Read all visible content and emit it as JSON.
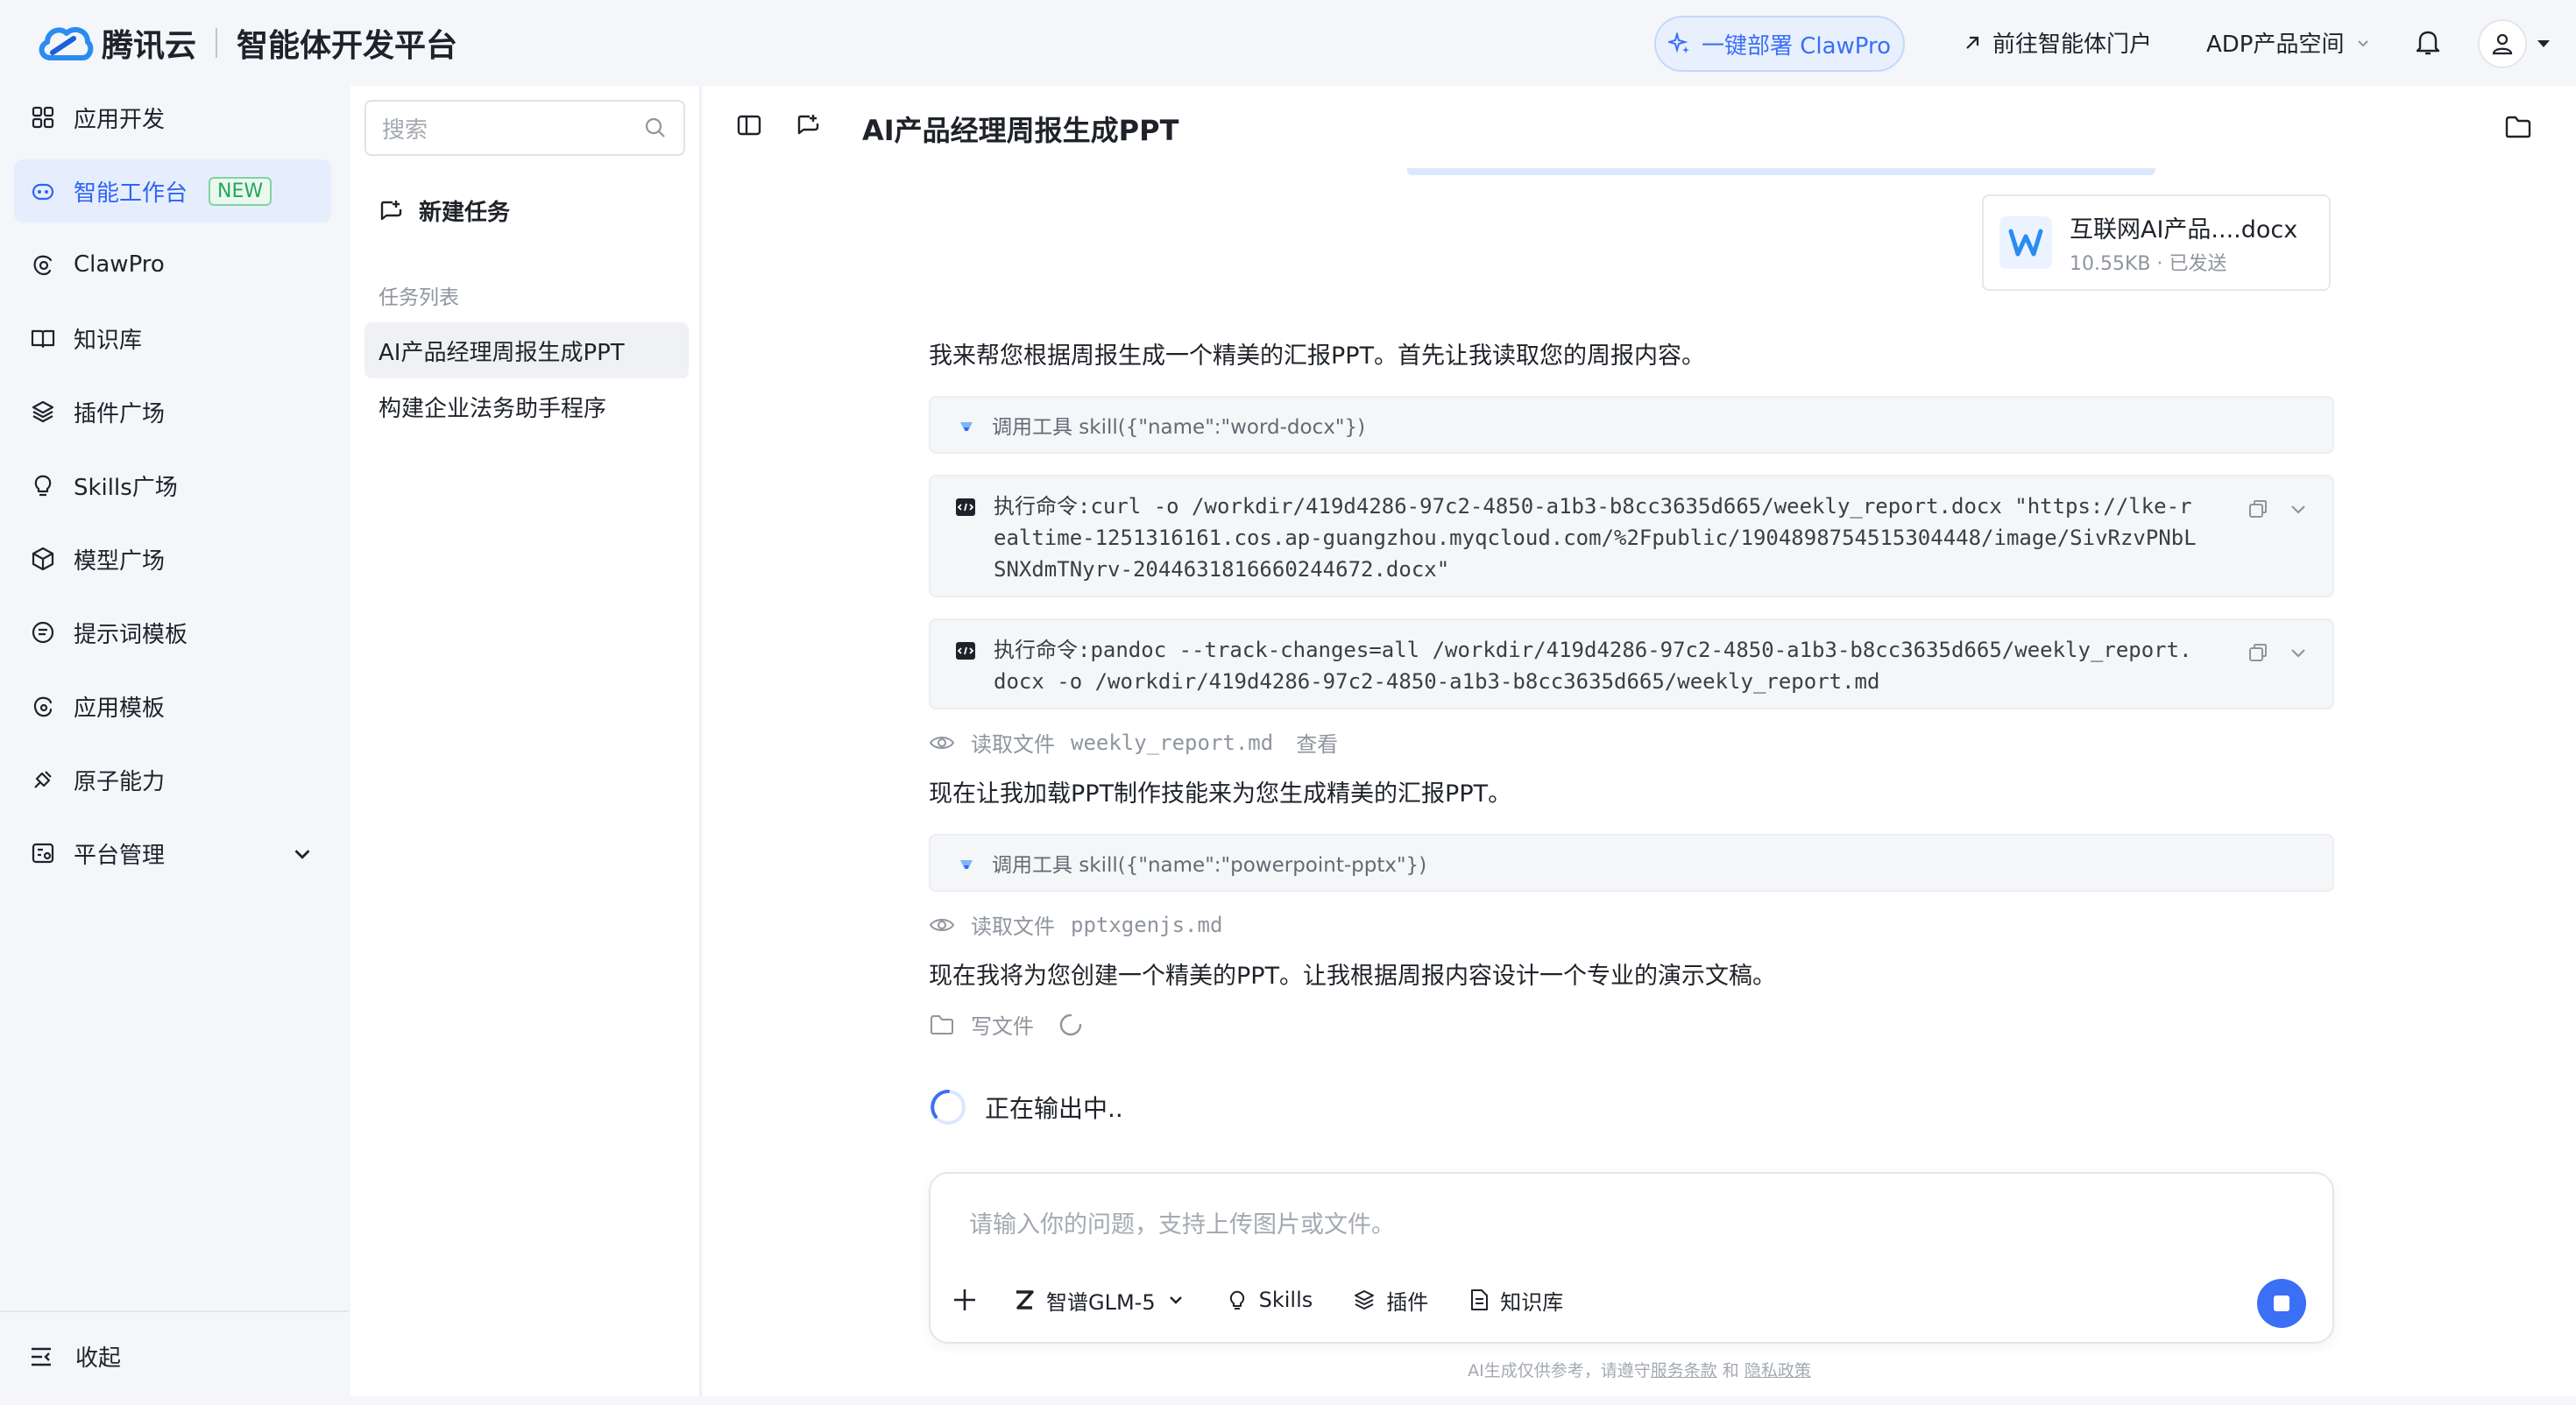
{
  "header": {
    "brand": "腾讯云",
    "platform_title": "智能体开发平台",
    "clawpro_button": "一键部署 ClawPro",
    "portal_link": "前往智能体门户",
    "product_space": "ADP产品空间"
  },
  "sidebar": {
    "items": [
      {
        "label": "应用开发",
        "icon": "grid-icon"
      },
      {
        "label": "智能工作台",
        "icon": "robot-icon",
        "badge": "NEW",
        "active": true
      },
      {
        "label": "ClawPro",
        "icon": "claw-icon"
      },
      {
        "label": "知识库",
        "icon": "book-icon"
      },
      {
        "label": "插件广场",
        "icon": "layers-icon"
      },
      {
        "label": "Skills广场",
        "icon": "bulb-icon"
      },
      {
        "label": "模型广场",
        "icon": "cube-icon"
      },
      {
        "label": "提示词模板",
        "icon": "message-icon"
      },
      {
        "label": "应用模板",
        "icon": "template-icon"
      },
      {
        "label": "原子能力",
        "icon": "atom-icon"
      },
      {
        "label": "平台管理",
        "icon": "settings-icon"
      }
    ],
    "collapse_label": "收起"
  },
  "tasks": {
    "search_placeholder": "搜索",
    "new_task": "新建任务",
    "section_label": "任务列表",
    "items": [
      "AI产品经理周报生成PPT",
      "构建企业法务助手程序"
    ]
  },
  "chat": {
    "title": "AI产品经理周报生成PPT",
    "file": {
      "name": "互联网AI产品....docx",
      "meta": "10.55KB · 已发送"
    },
    "msg1": "我来帮您根据周报生成一个精美的汇报PPT。首先让我读取您的周报内容。",
    "tool1": "调用工具 skill({\"name\":\"word-docx\"})",
    "cmd1": "执行命令:curl -o /workdir/419d4286-97c2-4850-a1b3-b8cc3635d665/weekly_report.docx \"https://lke-realtime-1251316161.cos.ap-guangzhou.myqcloud.com/%2Fpublic/1904898754515304448/image/SivRzvPNbLSNXdmTNyrv-2044631816660244672.docx\"",
    "cmd2": "执行命令:pandoc --track-changes=all /workdir/419d4286-97c2-4850-a1b3-b8cc3635d665/weekly_report.docx -o /workdir/419d4286-97c2-4850-a1b3-b8cc3635d665/weekly_report.md",
    "read1_label": "读取文件",
    "read1_file": "weekly_report.md",
    "read1_view": "查看",
    "msg2": "现在让我加载PPT制作技能来为您生成精美的汇报PPT。",
    "tool2": "调用工具 skill({\"name\":\"powerpoint-pptx\"})",
    "read2_label": "读取文件",
    "read2_file": "pptxgenjs.md",
    "msg3": "现在我将为您创建一个精美的PPT。让我根据周报内容设计一个专业的演示文稿。",
    "write_label": "写文件",
    "status": "正在输出中.."
  },
  "composer": {
    "placeholder": "请输入你的问题，支持上传图片或文件。",
    "model": "智谱GLM-5",
    "skills": "Skills",
    "plugins": "插件",
    "knowledge": "知识库"
  },
  "footer": {
    "prefix": "AI生成仅供参考，请遵守",
    "terms": "服务条款",
    "and": "和",
    "privacy": "隐私政策"
  },
  "colors": {
    "accent": "#3b6ff5",
    "active_bg": "#e6eefe",
    "badge_green": "#22a856"
  }
}
